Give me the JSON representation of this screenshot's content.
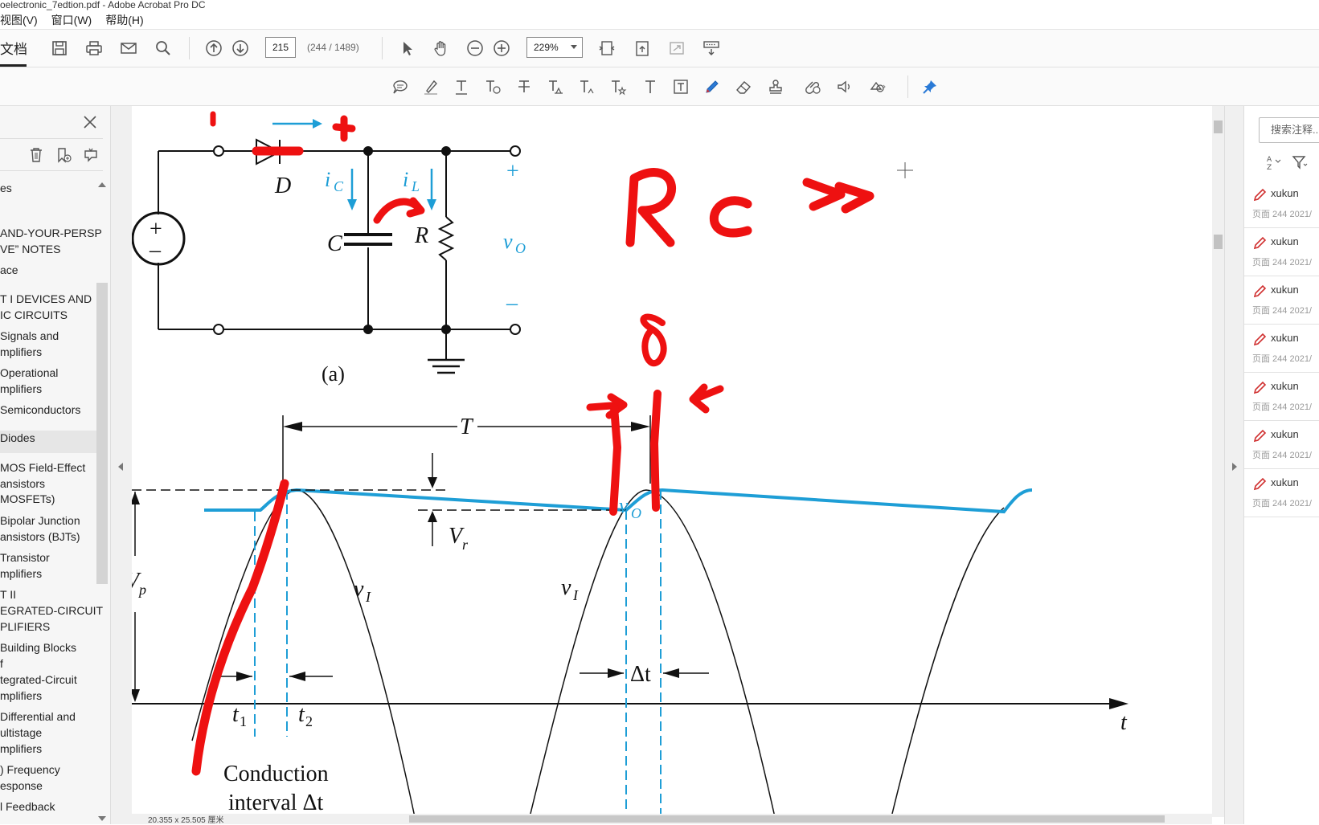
{
  "window": {
    "title": "oelectronic_7edtion.pdf - Adobe Acrobat Pro DC"
  },
  "menu": {
    "items": [
      "视图(V)",
      "窗口(W)",
      "帮助(H)"
    ]
  },
  "toolbar": {
    "doc_tab": "文档",
    "page_number": "215",
    "page_count": "(244 / 1489)",
    "zoom": "229%"
  },
  "left_panel": {
    "items": [
      {
        "label": "es"
      },
      {
        "label": "AND-YOUR-PERSP"
      },
      {
        "label": "VE” NOTES"
      },
      {
        "label": "ace"
      },
      {
        "label": "T I DEVICES AND"
      },
      {
        "label": "IC CIRCUITS"
      },
      {
        "label": "Signals and"
      },
      {
        "label": "mplifiers"
      },
      {
        "label": "Operational"
      },
      {
        "label": "mplifiers"
      },
      {
        "label": "Semiconductors"
      },
      {
        "label": "Diodes",
        "selected": true
      },
      {
        "label": "MOS Field-Effect"
      },
      {
        "label": "ansistors"
      },
      {
        "label": "MOSFETs)"
      },
      {
        "label": "Bipolar Junction"
      },
      {
        "label": "ansistors (BJTs)"
      },
      {
        "label": "Transistor"
      },
      {
        "label": "mplifiers"
      },
      {
        "label": "T II"
      },
      {
        "label": "EGRATED-CIRCUIT"
      },
      {
        "label": "PLIFIERS"
      },
      {
        "label": "Building Blocks"
      },
      {
        "label": "f"
      },
      {
        "label": "tegrated-Circuit"
      },
      {
        "label": "mplifiers"
      },
      {
        "label": "Differential and"
      },
      {
        "label": "ultistage"
      },
      {
        "label": "mplifiers"
      },
      {
        "label": ") Frequency"
      },
      {
        "label": "esponse"
      },
      {
        "label": "l Feedback"
      }
    ]
  },
  "document": {
    "circuit_labels": {
      "D": "D",
      "iC": "i",
      "iC_sub": "C",
      "iL": "i",
      "iL_sub": "L",
      "C": "C",
      "R": "R",
      "vO": "v",
      "vO_sub": "O",
      "plus": "+",
      "minus": "–",
      "src_plus": "+",
      "src_minus": "–",
      "caption": "(a)"
    },
    "waveform_labels": {
      "T": "T",
      "Vr": "V",
      "Vr_sub": "r",
      "Vp": "V",
      "Vp_sub": "p",
      "vI_1": "v",
      "vI_1_sub": "I",
      "vI_2": "v",
      "vI_2_sub": "I",
      "vO": "v",
      "vO_sub": "O",
      "delta_t": "Δt",
      "t1": "t",
      "t1_sub": "1",
      "t2": "t",
      "t2_sub": "2",
      "t": "t",
      "conduction_1": "Conduction",
      "conduction_2": "interval Δt"
    },
    "status_size": "20.355 x 25.505 厘米"
  },
  "colors": {
    "ink_red": "#ee1111",
    "cyan": "#1e9ed6",
    "pen_icon": "#d03030"
  },
  "right_panel": {
    "search_placeholder": "搜索注释...",
    "comments": [
      {
        "author": "xukun",
        "meta": "页面 244   2021/"
      },
      {
        "author": "xukun",
        "meta": "页面 244   2021/"
      },
      {
        "author": "xukun",
        "meta": "页面 244   2021/"
      },
      {
        "author": "xukun",
        "meta": "页面 244   2021/"
      },
      {
        "author": "xukun",
        "meta": "页面 244   2021/"
      },
      {
        "author": "xukun",
        "meta": "页面 244   2021/"
      },
      {
        "author": "xukun",
        "meta": "页面 244   2021/"
      }
    ]
  }
}
